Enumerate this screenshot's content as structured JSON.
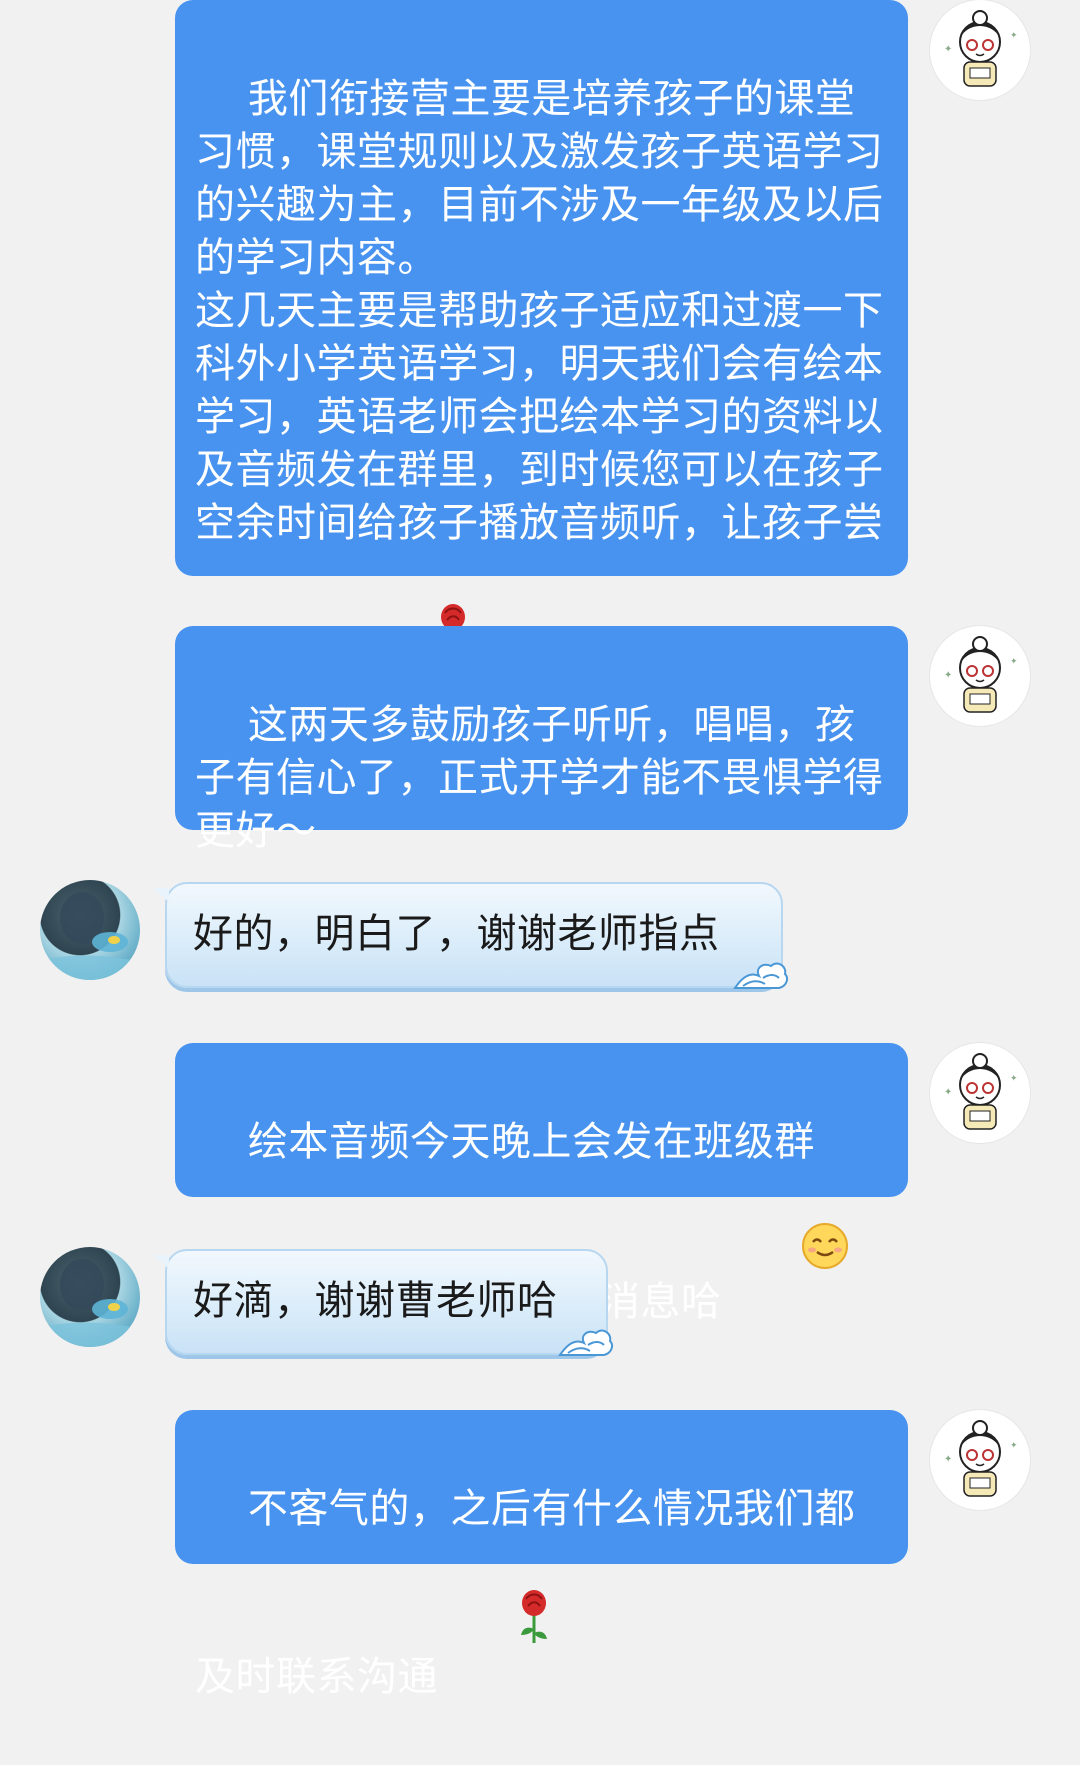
{
  "messages": [
    {
      "side": "out",
      "text": "我们衔接营主要是培养孩子的课堂习惯，课堂规则以及激发孩子英语学习的兴趣为主，目前不涉及一年级及以后的学习内容。\n这几天主要是帮助孩子适应和过渡一下科外小学英语学习，明天我们会有绘本学习，英语老师会把绘本学习的资料以及音频发在群里，到时候您可以在孩子空余时间给孩子播放音频听，让孩子尝试说一说",
      "emoji": "rose-icon"
    },
    {
      "side": "out",
      "text": "这两天多鼓励孩子听听，唱唱，孩子有信心了，正式开学才能不畏惧学得更好～"
    },
    {
      "side": "in",
      "text": "好的，明白了，谢谢老师指点"
    },
    {
      "side": "out",
      "text": "绘本音频今天晚上会发在班级群里，您可以关注一下群消息哈",
      "emoji": "smile-icon"
    },
    {
      "side": "in",
      "text": "好滴，谢谢曹老师哈"
    },
    {
      "side": "out",
      "text": "不客气的，之后有什么情况我们都及时联系沟通",
      "emoji": "rose-icon"
    }
  ],
  "colors": {
    "background": "#f1f1f1",
    "outgoing_bubble": "#4893f0",
    "incoming_bubble": "#dbedfa"
  }
}
